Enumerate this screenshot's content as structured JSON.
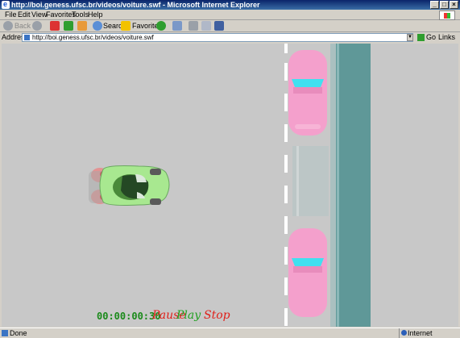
{
  "window": {
    "title": "http://boi.geness.ufsc.br/videos/voiture.swf - Microsoft Internet Explorer"
  },
  "menu": [
    "File",
    "Edit",
    "View",
    "Favorites",
    "Tools",
    "Help"
  ],
  "toolbar": {
    "back": "Back",
    "search": "Search",
    "favorites": "Favorites"
  },
  "address": {
    "label": "Address",
    "url": "http://boi.geness.ufsc.br/videos/voiture.swf",
    "go": "Go",
    "links": "Links"
  },
  "flash": {
    "timer": "00:00:00:30",
    "pause": "Pause",
    "play": "Play",
    "stop": "Stop",
    "colors": {
      "pause": "#e0201a",
      "play": "#22a022",
      "stop": "#e0201a",
      "car_green": "#a8e890",
      "car_pink": "#f4a0cc",
      "water": "#5f9898"
    }
  },
  "status": {
    "text": "Done",
    "zone": "Internet"
  }
}
